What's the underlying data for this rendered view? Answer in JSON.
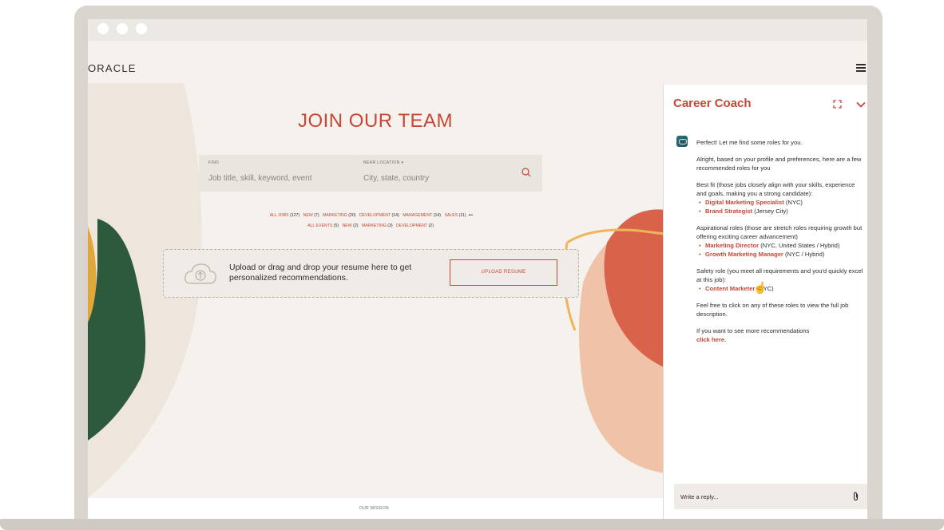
{
  "site": {
    "logo": "ORACLE",
    "hero_title": "JOIN OUR TEAM",
    "footer_link": "OUR MISSION"
  },
  "search": {
    "find_label": "FIND",
    "find_placeholder": "Job title, skill, keyword, event",
    "location_label": "NEAR LOCATION ▾",
    "location_placeholder": "City, state, country"
  },
  "filters": {
    "jobs": [
      {
        "label": "ALL JOBS",
        "count": "(127)"
      },
      {
        "label": "NEW",
        "count": "(7)"
      },
      {
        "label": "MARKETING",
        "count": "(20)"
      },
      {
        "label": "DEVELOPMENT",
        "count": "(14)"
      },
      {
        "label": "MANAGEMENT",
        "count": "(14)"
      },
      {
        "label": "SALES",
        "count": "(11)"
      }
    ],
    "more": "•••",
    "events": [
      {
        "label": "ALL EVENTS",
        "count": "(5)"
      },
      {
        "label": "NEW",
        "count": "(2)"
      },
      {
        "label": "MARKETING",
        "count": "(3)"
      },
      {
        "label": "DEVELOPMENT",
        "count": "(2)"
      }
    ]
  },
  "upload": {
    "text": "Upload or drag and drop your resume here to get personalized recommendations.",
    "button": "UPLOAD RESUME"
  },
  "coach": {
    "title": "Career Coach",
    "intro": "Perfect! Let me find some roles for you.",
    "lead": "Alright, based on your profile and preferences, here are a few recommended roles for you",
    "best_fit_heading": "Best fit (those jobs closely align with your skills, experience and goals, making you a strong candidate):",
    "best_fit": [
      {
        "role": "Digital Marketing Specialist",
        "location": " (NYC)"
      },
      {
        "role": "Brand Strategist",
        "location": " (Jersey City)"
      }
    ],
    "aspirational_heading": "Aspirational roles (those are stretch roles requiring growth but offering exciting career advancement)",
    "aspirational": [
      {
        "role": "Marketing Director",
        "location": " (NYC, United States / Hybrid)"
      },
      {
        "role": "Growth Marketing Manager",
        "location": " (NYC / Hybrid)"
      }
    ],
    "safety_heading": "Safety role (you meet all requirements and you'd quickly excel at this job):",
    "safety": [
      {
        "role": "Content Marketer",
        "location": " (NYC)"
      }
    ],
    "closing": "Feel free to click on any of these roles to view the full job description.",
    "more_text": "If you want to see more recommendations",
    "more_link": "click here.",
    "reply_placeholder": "Write a reply..."
  },
  "colors": {
    "accent": "#c74634",
    "background": "#f5f2ee",
    "text": "#312d2a"
  }
}
